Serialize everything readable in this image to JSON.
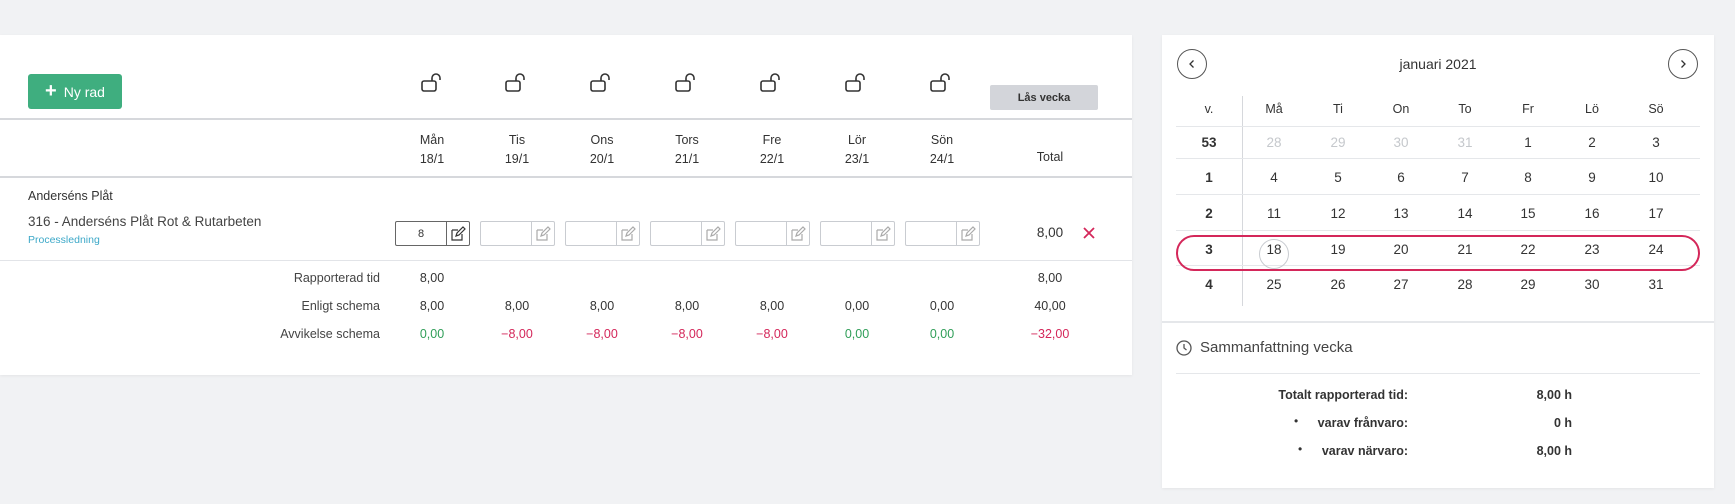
{
  "toolbar": {
    "new_row_label": "Ny rad",
    "lock_week_label": "Lås vecka"
  },
  "days": [
    {
      "name": "Mån",
      "date": "18/1"
    },
    {
      "name": "Tis",
      "date": "19/1"
    },
    {
      "name": "Ons",
      "date": "20/1"
    },
    {
      "name": "Tors",
      "date": "21/1"
    },
    {
      "name": "Fre",
      "date": "22/1"
    },
    {
      "name": "Lör",
      "date": "23/1"
    },
    {
      "name": "Sön",
      "date": "24/1"
    }
  ],
  "total_header": "Total",
  "project": {
    "name": "Anderséns Plåt",
    "task": "316 - Anderséns Plåt Rot & Rutarbeten",
    "subtask": "Processledning",
    "hours": [
      "8",
      "",
      "",
      "",
      "",
      "",
      ""
    ],
    "total": "8,00"
  },
  "summary": {
    "reported": {
      "label": "Rapporterad tid",
      "values": [
        "8,00",
        "",
        "",
        "",
        "",
        "",
        ""
      ],
      "total": "8,00"
    },
    "scheduled": {
      "label": "Enligt schema",
      "values": [
        "8,00",
        "8,00",
        "8,00",
        "8,00",
        "8,00",
        "0,00",
        "0,00"
      ],
      "total": "40,00"
    },
    "deviation": {
      "label": "Avvikelse schema",
      "values": [
        "0,00",
        "−8,00",
        "−8,00",
        "−8,00",
        "−8,00",
        "0,00",
        "0,00"
      ],
      "total": "−32,00"
    }
  },
  "calendar": {
    "month_label": "januari 2021",
    "week_header": "v.",
    "weekday_headers": [
      "Må",
      "Ti",
      "On",
      "To",
      "Fr",
      "Lö",
      "Sö"
    ],
    "weeks": [
      {
        "week": "53",
        "days": [
          "28",
          "29",
          "30",
          "31",
          "1",
          "2",
          "3"
        ]
      },
      {
        "week": "1",
        "days": [
          "4",
          "5",
          "6",
          "7",
          "8",
          "9",
          "10"
        ]
      },
      {
        "week": "2",
        "days": [
          "11",
          "12",
          "13",
          "14",
          "15",
          "16",
          "17"
        ]
      },
      {
        "week": "3",
        "days": [
          "18",
          "19",
          "20",
          "21",
          "22",
          "23",
          "24"
        ]
      },
      {
        "week": "4",
        "days": [
          "25",
          "26",
          "27",
          "28",
          "29",
          "30",
          "31"
        ]
      }
    ]
  },
  "week_summary": {
    "title": "Sammanfattning vecka",
    "total_label": "Totalt rapporterad tid:",
    "total_value": "8,00 h",
    "absence_label": "varav frånvaro:",
    "absence_value": "0 h",
    "presence_label": "varav närvaro:",
    "presence_value": "8,00 h"
  },
  "colors": {
    "accent_green": "#3fae7f",
    "positive": "#2f9e58",
    "negative": "#d4275a",
    "link": "#3ca8c8"
  }
}
